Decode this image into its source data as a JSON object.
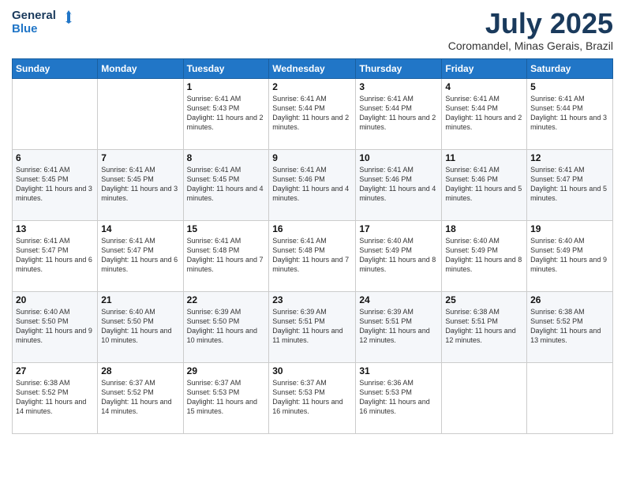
{
  "header": {
    "logo_line1": "General",
    "logo_line2": "Blue",
    "main_title": "July 2025",
    "subtitle": "Coromandel, Minas Gerais, Brazil"
  },
  "weekdays": [
    "Sunday",
    "Monday",
    "Tuesday",
    "Wednesday",
    "Thursday",
    "Friday",
    "Saturday"
  ],
  "weeks": [
    [
      {
        "day": "",
        "detail": ""
      },
      {
        "day": "",
        "detail": ""
      },
      {
        "day": "1",
        "detail": "Sunrise: 6:41 AM\nSunset: 5:43 PM\nDaylight: 11 hours and 2 minutes."
      },
      {
        "day": "2",
        "detail": "Sunrise: 6:41 AM\nSunset: 5:44 PM\nDaylight: 11 hours and 2 minutes."
      },
      {
        "day": "3",
        "detail": "Sunrise: 6:41 AM\nSunset: 5:44 PM\nDaylight: 11 hours and 2 minutes."
      },
      {
        "day": "4",
        "detail": "Sunrise: 6:41 AM\nSunset: 5:44 PM\nDaylight: 11 hours and 2 minutes."
      },
      {
        "day": "5",
        "detail": "Sunrise: 6:41 AM\nSunset: 5:44 PM\nDaylight: 11 hours and 3 minutes."
      }
    ],
    [
      {
        "day": "6",
        "detail": "Sunrise: 6:41 AM\nSunset: 5:45 PM\nDaylight: 11 hours and 3 minutes."
      },
      {
        "day": "7",
        "detail": "Sunrise: 6:41 AM\nSunset: 5:45 PM\nDaylight: 11 hours and 3 minutes."
      },
      {
        "day": "8",
        "detail": "Sunrise: 6:41 AM\nSunset: 5:45 PM\nDaylight: 11 hours and 4 minutes."
      },
      {
        "day": "9",
        "detail": "Sunrise: 6:41 AM\nSunset: 5:46 PM\nDaylight: 11 hours and 4 minutes."
      },
      {
        "day": "10",
        "detail": "Sunrise: 6:41 AM\nSunset: 5:46 PM\nDaylight: 11 hours and 4 minutes."
      },
      {
        "day": "11",
        "detail": "Sunrise: 6:41 AM\nSunset: 5:46 PM\nDaylight: 11 hours and 5 minutes."
      },
      {
        "day": "12",
        "detail": "Sunrise: 6:41 AM\nSunset: 5:47 PM\nDaylight: 11 hours and 5 minutes."
      }
    ],
    [
      {
        "day": "13",
        "detail": "Sunrise: 6:41 AM\nSunset: 5:47 PM\nDaylight: 11 hours and 6 minutes."
      },
      {
        "day": "14",
        "detail": "Sunrise: 6:41 AM\nSunset: 5:47 PM\nDaylight: 11 hours and 6 minutes."
      },
      {
        "day": "15",
        "detail": "Sunrise: 6:41 AM\nSunset: 5:48 PM\nDaylight: 11 hours and 7 minutes."
      },
      {
        "day": "16",
        "detail": "Sunrise: 6:41 AM\nSunset: 5:48 PM\nDaylight: 11 hours and 7 minutes."
      },
      {
        "day": "17",
        "detail": "Sunrise: 6:40 AM\nSunset: 5:49 PM\nDaylight: 11 hours and 8 minutes."
      },
      {
        "day": "18",
        "detail": "Sunrise: 6:40 AM\nSunset: 5:49 PM\nDaylight: 11 hours and 8 minutes."
      },
      {
        "day": "19",
        "detail": "Sunrise: 6:40 AM\nSunset: 5:49 PM\nDaylight: 11 hours and 9 minutes."
      }
    ],
    [
      {
        "day": "20",
        "detail": "Sunrise: 6:40 AM\nSunset: 5:50 PM\nDaylight: 11 hours and 9 minutes."
      },
      {
        "day": "21",
        "detail": "Sunrise: 6:40 AM\nSunset: 5:50 PM\nDaylight: 11 hours and 10 minutes."
      },
      {
        "day": "22",
        "detail": "Sunrise: 6:39 AM\nSunset: 5:50 PM\nDaylight: 11 hours and 10 minutes."
      },
      {
        "day": "23",
        "detail": "Sunrise: 6:39 AM\nSunset: 5:51 PM\nDaylight: 11 hours and 11 minutes."
      },
      {
        "day": "24",
        "detail": "Sunrise: 6:39 AM\nSunset: 5:51 PM\nDaylight: 11 hours and 12 minutes."
      },
      {
        "day": "25",
        "detail": "Sunrise: 6:38 AM\nSunset: 5:51 PM\nDaylight: 11 hours and 12 minutes."
      },
      {
        "day": "26",
        "detail": "Sunrise: 6:38 AM\nSunset: 5:52 PM\nDaylight: 11 hours and 13 minutes."
      }
    ],
    [
      {
        "day": "27",
        "detail": "Sunrise: 6:38 AM\nSunset: 5:52 PM\nDaylight: 11 hours and 14 minutes."
      },
      {
        "day": "28",
        "detail": "Sunrise: 6:37 AM\nSunset: 5:52 PM\nDaylight: 11 hours and 14 minutes."
      },
      {
        "day": "29",
        "detail": "Sunrise: 6:37 AM\nSunset: 5:53 PM\nDaylight: 11 hours and 15 minutes."
      },
      {
        "day": "30",
        "detail": "Sunrise: 6:37 AM\nSunset: 5:53 PM\nDaylight: 11 hours and 16 minutes."
      },
      {
        "day": "31",
        "detail": "Sunrise: 6:36 AM\nSunset: 5:53 PM\nDaylight: 11 hours and 16 minutes."
      },
      {
        "day": "",
        "detail": ""
      },
      {
        "day": "",
        "detail": ""
      }
    ]
  ]
}
